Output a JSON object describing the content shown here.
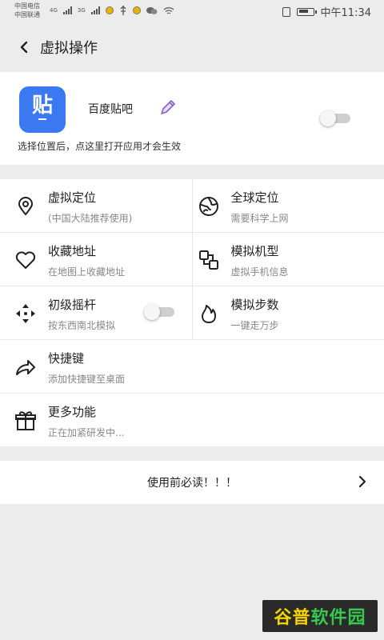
{
  "status_bar": {
    "carrier_1": "中国电信",
    "carrier_2": "中国联通",
    "net_1": "4G",
    "net_2": "3G",
    "time": "中午11:34"
  },
  "header": {
    "title": "虚拟操作"
  },
  "app": {
    "icon_glyph": "贴",
    "name": "百度贴吧",
    "hint": "选择位置后，点这里打开应用才会生效",
    "toggle_on": false,
    "icon_color": "#3b79f3"
  },
  "features": {
    "virtual_location": {
      "label": "虚拟定位",
      "sub": "(中国大陆推荐使用)",
      "icon": "location-pin-icon"
    },
    "global_location": {
      "label": "全球定位",
      "sub": "需要科学上网",
      "icon": "globe-icon"
    },
    "favorites": {
      "label": "收藏地址",
      "sub": "在地图上收藏地址",
      "icon": "heart-icon"
    },
    "device_model": {
      "label": "模拟机型",
      "sub": "虚拟手机信息",
      "icon": "device-model-icon"
    },
    "joystick": {
      "label": "初级摇杆",
      "sub": "按东西南北模拟",
      "icon": "move-arrows-icon",
      "toggle_on": false
    },
    "steps": {
      "label": "模拟步数",
      "sub": "一键走万步",
      "icon": "flame-icon"
    },
    "shortcut": {
      "label": "快捷键",
      "sub": "添加快捷键至桌面",
      "icon": "share-arrow-icon"
    },
    "more": {
      "label": "更多功能",
      "sub": "正在加紧研发中...",
      "icon": "gift-icon"
    }
  },
  "notice": {
    "text": "使用前必读！！！"
  },
  "watermark": {
    "part_1": "谷普",
    "part_2": "软件园"
  }
}
